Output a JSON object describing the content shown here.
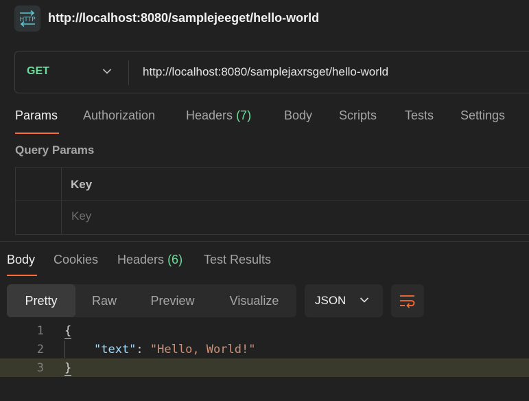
{
  "header": {
    "icon": "http-icon",
    "icon_text": "HTTP",
    "title": "http://localhost:8080/samplejeeget/hello-world"
  },
  "request": {
    "method": "GET",
    "url": "http://localhost:8080/samplejaxrsget/hello-world"
  },
  "request_tabs": [
    {
      "label": "Params",
      "count": "",
      "active": true
    },
    {
      "label": "Authorization",
      "count": ""
    },
    {
      "label": "Headers",
      "count": "(7)"
    },
    {
      "label": "Body",
      "count": ""
    },
    {
      "label": "Scripts",
      "count": ""
    },
    {
      "label": "Tests",
      "count": ""
    },
    {
      "label": "Settings",
      "count": ""
    }
  ],
  "query_params": {
    "label": "Query Params",
    "column_header": "Key",
    "key_placeholder": "Key"
  },
  "response_tabs": [
    {
      "label": "Body",
      "count": "",
      "active": true
    },
    {
      "label": "Cookies",
      "count": ""
    },
    {
      "label": "Headers",
      "count": "(6)"
    },
    {
      "label": "Test Results",
      "count": ""
    }
  ],
  "format_buttons": [
    {
      "label": "Pretty",
      "active": true
    },
    {
      "label": "Raw"
    },
    {
      "label": "Preview"
    },
    {
      "label": "Visualize"
    }
  ],
  "response_format": "JSON",
  "code_lines": [
    {
      "number": "1",
      "text": "{"
    },
    {
      "number": "2",
      "key": "\"text\"",
      "sep": ": ",
      "value": "\"Hello, World!\""
    },
    {
      "number": "3",
      "text": "}"
    }
  ],
  "colors": {
    "accent": "#ff6c37",
    "method_green": "#6bdd9a",
    "count_green": "#6bdd9a",
    "json_key": "#9cdcfe",
    "json_string": "#ce9178"
  }
}
